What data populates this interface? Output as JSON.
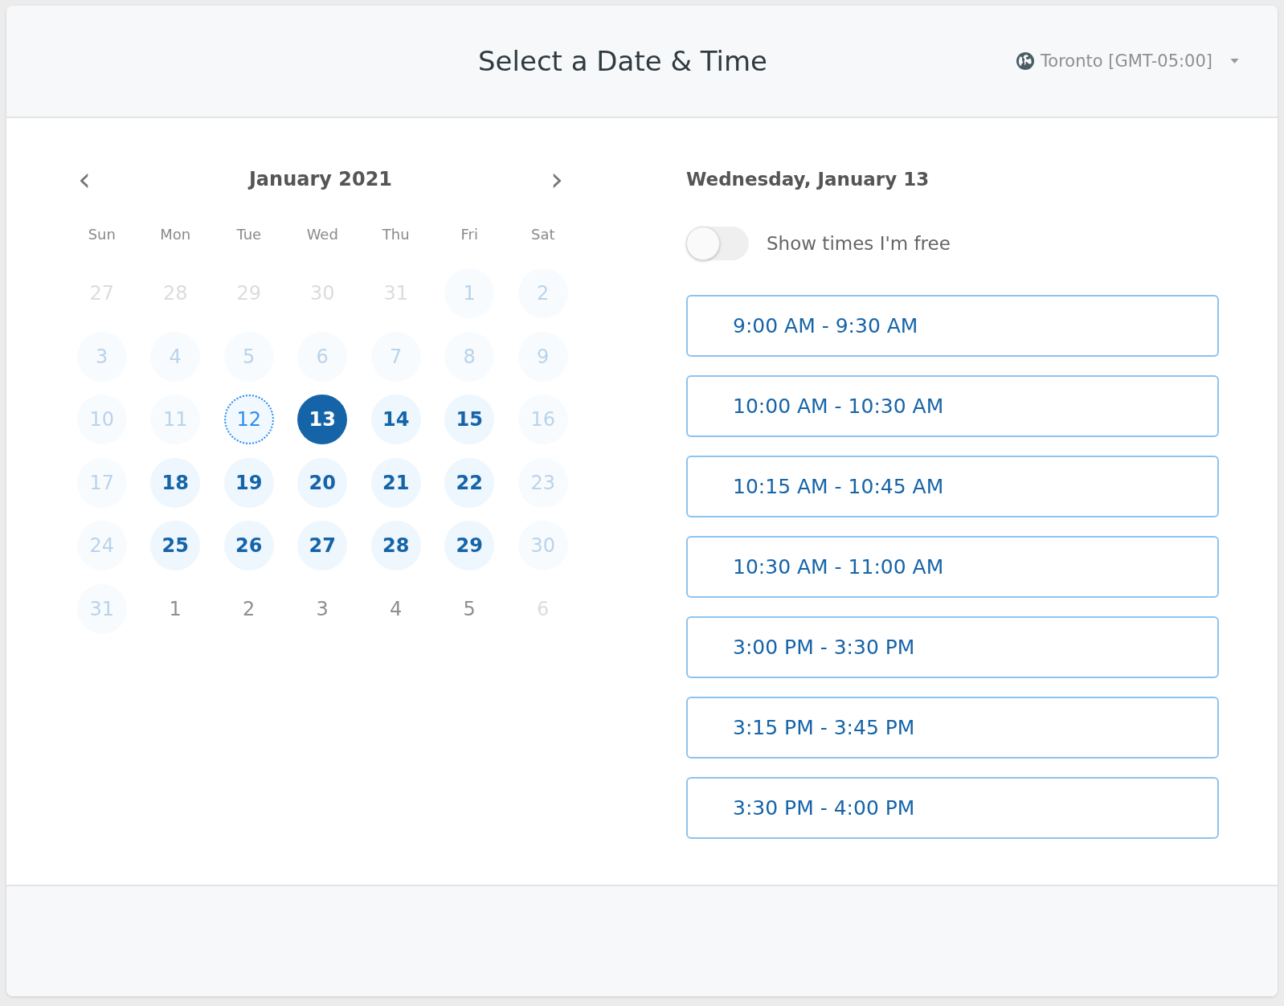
{
  "header": {
    "title": "Select a Date & Time",
    "timezone": "Toronto [GMT-05:00]"
  },
  "calendar": {
    "month": "January 2021",
    "prev": "‹",
    "next": "›",
    "weekdays": [
      "Sun",
      "Mon",
      "Tue",
      "Wed",
      "Thu",
      "Fri",
      "Sat"
    ],
    "days": [
      {
        "label": "27",
        "kind": "outside-dim",
        "selected": false
      },
      {
        "label": "28",
        "kind": "outside-dim",
        "selected": false
      },
      {
        "label": "29",
        "kind": "outside-dim",
        "selected": false
      },
      {
        "label": "30",
        "kind": "outside-dim",
        "selected": false
      },
      {
        "label": "31",
        "kind": "outside-dim",
        "selected": false
      },
      {
        "label": "1",
        "kind": "unavailable",
        "selected": false
      },
      {
        "label": "2",
        "kind": "unavailable",
        "selected": false
      },
      {
        "label": "3",
        "kind": "unavailable",
        "selected": false
      },
      {
        "label": "4",
        "kind": "unavailable",
        "selected": false
      },
      {
        "label": "5",
        "kind": "unavailable",
        "selected": false
      },
      {
        "label": "6",
        "kind": "unavailable",
        "selected": false
      },
      {
        "label": "7",
        "kind": "unavailable",
        "selected": false
      },
      {
        "label": "8",
        "kind": "unavailable",
        "selected": false
      },
      {
        "label": "9",
        "kind": "unavailable",
        "selected": false
      },
      {
        "label": "10",
        "kind": "unavailable",
        "selected": false
      },
      {
        "label": "11",
        "kind": "unavailable",
        "selected": false
      },
      {
        "label": "12",
        "kind": "today",
        "selected": false
      },
      {
        "label": "13",
        "kind": "available",
        "selected": true
      },
      {
        "label": "14",
        "kind": "available",
        "selected": false
      },
      {
        "label": "15",
        "kind": "available",
        "selected": false
      },
      {
        "label": "16",
        "kind": "unavailable",
        "selected": false
      },
      {
        "label": "17",
        "kind": "unavailable",
        "selected": false
      },
      {
        "label": "18",
        "kind": "available",
        "selected": false
      },
      {
        "label": "19",
        "kind": "available",
        "selected": false
      },
      {
        "label": "20",
        "kind": "available",
        "selected": false
      },
      {
        "label": "21",
        "kind": "available",
        "selected": false
      },
      {
        "label": "22",
        "kind": "available",
        "selected": false
      },
      {
        "label": "23",
        "kind": "unavailable",
        "selected": false
      },
      {
        "label": "24",
        "kind": "unavailable",
        "selected": false
      },
      {
        "label": "25",
        "kind": "available",
        "selected": false
      },
      {
        "label": "26",
        "kind": "available",
        "selected": false
      },
      {
        "label": "27",
        "kind": "available",
        "selected": false
      },
      {
        "label": "28",
        "kind": "available",
        "selected": false
      },
      {
        "label": "29",
        "kind": "available",
        "selected": false
      },
      {
        "label": "30",
        "kind": "unavailable",
        "selected": false
      },
      {
        "label": "31",
        "kind": "unavailable",
        "selected": false
      },
      {
        "label": "1",
        "kind": "outside",
        "selected": false
      },
      {
        "label": "2",
        "kind": "outside",
        "selected": false
      },
      {
        "label": "3",
        "kind": "outside",
        "selected": false
      },
      {
        "label": "4",
        "kind": "outside",
        "selected": false
      },
      {
        "label": "5",
        "kind": "outside",
        "selected": false
      },
      {
        "label": "6",
        "kind": "outside-dim",
        "selected": false
      }
    ]
  },
  "times": {
    "date": "Wednesday, January 13",
    "toggle": {
      "label": "Show times I'm free",
      "on": false
    },
    "slots": [
      "9:00 AM - 9:30 AM",
      "10:00 AM - 10:30 AM",
      "10:15 AM - 10:45 AM",
      "10:30 AM - 11:00 AM",
      "3:00 PM - 3:30 PM",
      "3:15 PM - 3:45 PM",
      "3:30 PM - 4:00 PM"
    ]
  }
}
